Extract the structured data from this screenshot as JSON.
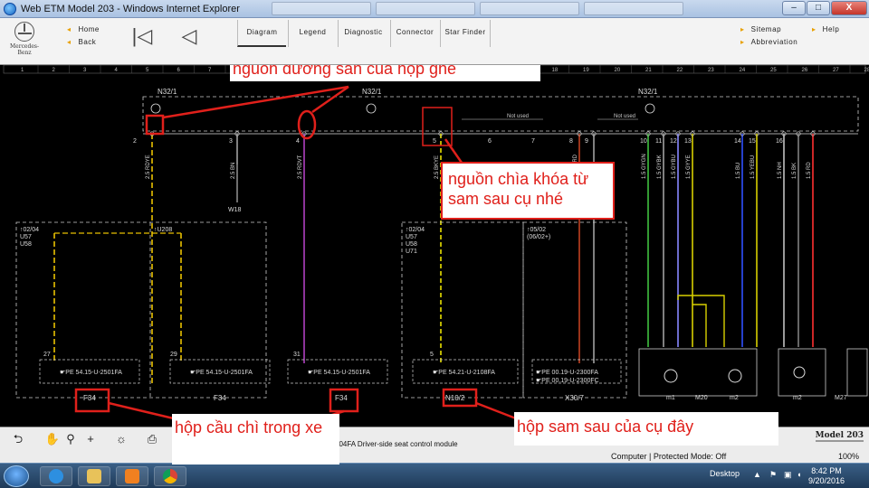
{
  "window": {
    "title": "Web ETM Model 203 - Windows Internet Explorer",
    "tabs_ghost": [
      "",
      "",
      "",
      ""
    ],
    "controls": {
      "min": "–",
      "max": "□",
      "close": "X"
    }
  },
  "toolbar": {
    "brand": "Mercedes-Benz",
    "home": "Home",
    "back": "Back",
    "first_icon": "first-page-icon",
    "prev_icon": "prev-page-icon",
    "tabs": [
      "Diagram",
      "Legend",
      "Diagnostic",
      "Connector",
      "Star Finder"
    ],
    "sitemap": "Sitemap",
    "help": "Help",
    "abbreviation": "Abbreviation"
  },
  "diagram": {
    "ruler": [
      "1",
      "2",
      "3",
      "4",
      "5",
      "6",
      "7",
      "8",
      "9",
      "10",
      "11",
      "12",
      "13",
      "14",
      "15",
      "16",
      "17",
      "18",
      "19",
      "20",
      "21",
      "22",
      "23",
      "24",
      "25",
      "26",
      "27",
      "28"
    ],
    "connector_labels": [
      "N32/1",
      "N32/1",
      "N32/1"
    ],
    "not_used": [
      "Not used",
      "Not used"
    ],
    "pins": [
      "2",
      "3",
      "4",
      "5",
      "6",
      "7",
      "8",
      "9",
      "10",
      "11",
      "12",
      "13",
      "14",
      "15",
      "16"
    ],
    "wires": [
      {
        "label": "2.5 RDYE",
        "color": "#e8c000"
      },
      {
        "label": "2.5 BN",
        "color": "#a0a0a0"
      },
      {
        "label": "2.5 RDVT",
        "color": "#b040c0"
      },
      {
        "label": "2.5 BKYE",
        "color": "#e8e000"
      },
      {
        "label": "0.5 BNRD",
        "color": "#c04020"
      },
      {
        "label": "0.5 BN",
        "color": "#a0a0a0"
      },
      {
        "label": "1.5 GYGN",
        "color": "#40c040"
      },
      {
        "label": "1.5 GYBK",
        "color": "#a0a0a0"
      },
      {
        "label": "1.5 GYBU",
        "color": "#8888ff"
      },
      {
        "label": "1.5 GYYE",
        "color": "#d8d000"
      },
      {
        "label": "1.5 BU",
        "color": "#3050ff"
      },
      {
        "label": "1.5 YEBU",
        "color": "#d8d000"
      },
      {
        "label": "1.5 NH",
        "color": "#c0c0c0"
      },
      {
        "label": "1.5 BK",
        "color": "#808080"
      },
      {
        "label": "1.5 RD",
        "color": "#ff3030"
      }
    ],
    "ground": "W18",
    "modules": [
      {
        "tag": "02/04",
        "lines": [
          "U57",
          "U58"
        ],
        "pin": "27",
        "part": "PE 54.15-U-2501FA",
        "fuse": "F34"
      },
      {
        "tag": "U208",
        "lines": [],
        "pin": "29",
        "part": "PE 54.15-U-2501FA",
        "fuse": "F34"
      },
      {
        "tag": "",
        "lines": [],
        "pin": "31",
        "part": "PE 54.15-U-2501FA",
        "fuse": "F34"
      },
      {
        "tag": "02/04",
        "lines": [
          "U57",
          "U58",
          "U71"
        ],
        "pin": "5",
        "part": "PE 54.21-U-2108FA",
        "fuse": "N10/2"
      },
      {
        "tag": "05/02",
        "lines": [
          "(06/02+)"
        ],
        "pin": "",
        "part": "PE 00.19-U-2300FA",
        "part2": "PE 00.19-U-2300FC",
        "fuse": "X30/7"
      }
    ],
    "motors": [
      "m1",
      "M20",
      "m2",
      "m2",
      "M27"
    ],
    "annotations": {
      "seat_power": "nguồn dương sẵn của hộp ghế",
      "key_power": "nguồn chìa khóa từ sam sau cụ nhé",
      "fuse_box": "hộp cầu chì trong xe",
      "sam_box": "hộp sam sau của cụ đây"
    }
  },
  "bottombar": {
    "tools": [
      "back-arrow-icon",
      "hand-icon",
      "zoom-icon",
      "plus-icon",
      "bulb-icon",
      "print-icon"
    ],
    "status": "104FA   Driver-side seat control module",
    "model": "Model 203",
    "ie_status": "Computer | Protected Mode: Off",
    "zoom": "100%"
  },
  "taskbar": {
    "desktop": "Desktop",
    "time": "8:42 PM",
    "date": "9/20/2016"
  }
}
